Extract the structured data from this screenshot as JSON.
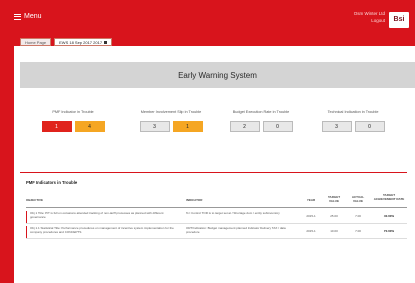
{
  "header": {
    "menu_label": "Menu",
    "user_line1": "Osm Winter Ltd",
    "user_line2": "Logout",
    "logo_text": "Bsi"
  },
  "tabs": [
    {
      "label": "Home Page",
      "active": false
    },
    {
      "label": "EWS  18 Sep 2017 2017",
      "active": true
    }
  ],
  "page_title": "Early Warning System",
  "kpis": [
    {
      "label": "PMF Indicator in Trouble",
      "values": [
        "1",
        "4"
      ],
      "colors": [
        "red",
        "orange"
      ]
    },
    {
      "label": "Member Involvement Slip in Trouble",
      "values": [
        "3",
        "1"
      ],
      "colors": [
        "gray",
        "orange"
      ]
    },
    {
      "label": "Budget Execution Rate in Trouble",
      "values": [
        "2",
        "0"
      ],
      "colors": [
        "gray",
        "gray"
      ]
    },
    {
      "label": "Technical Indication in Trouble",
      "values": [
        "3",
        "0"
      ],
      "colors": [
        "gray",
        "gray"
      ]
    }
  ],
  "section_title": "PMF Indicators in Trouble",
  "table": {
    "columns": [
      "OBJECTIVE",
      "INDICATOR",
      "YEAR",
      "TARGET VALUE",
      "ACTUAL VALUE",
      "TARGET ACHIEVEMENT RATE"
    ],
    "rows": [
      {
        "objective": "Obj 1 Title: PIT is full on occasions attended tracking of non-tariff processes as planned with different governance",
        "indicator": "% I Control TOR is to target set at / Shortage dom / entity subinventory",
        "year": "2015-1",
        "target": "25.00",
        "actual": "7.00",
        "rate": "40.00%"
      },
      {
        "objective": "Obj 1.1 Statistical Title: Performance procedures on management of incentive system implementation for the company procedures and CONCEPTS",
        "indicator": "ORT/Indication: Budget management planned Indicator Delivery TAX / data procedure",
        "year": "2015-1",
        "target": "10.00",
        "actual": "7.00",
        "rate": "70.00%"
      }
    ]
  }
}
